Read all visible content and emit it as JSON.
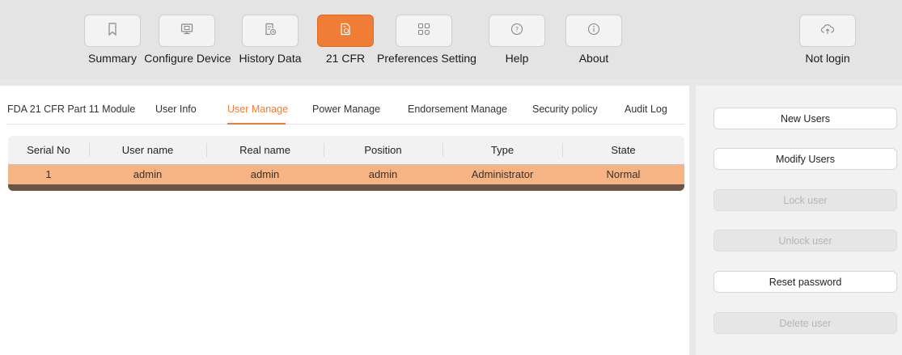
{
  "toolbar": {
    "items": [
      {
        "label": "Summary",
        "icon": "bookmark-icon",
        "active": false
      },
      {
        "label": "Configure Device",
        "icon": "device-icon",
        "active": false
      },
      {
        "label": "History Data",
        "icon": "history-icon",
        "active": false
      },
      {
        "label": "21 CFR",
        "icon": "cfr-icon",
        "active": true
      },
      {
        "label": "Preferences Setting",
        "icon": "grid-icon",
        "active": false
      },
      {
        "label": "Help",
        "icon": "help-icon",
        "active": false
      },
      {
        "label": "About",
        "icon": "info-icon",
        "active": false
      },
      {
        "label": "Not login",
        "icon": "cloud-upload-icon",
        "active": false
      }
    ],
    "accent_color": "#ef7d35"
  },
  "tabs": [
    {
      "label": "FDA 21 CFR Part 11 Module",
      "active": false
    },
    {
      "label": "User Info",
      "active": false
    },
    {
      "label": "User Manage",
      "active": true
    },
    {
      "label": "Power Manage",
      "active": false
    },
    {
      "label": "Endorsement Manage",
      "active": false
    },
    {
      "label": "Security policy",
      "active": false
    },
    {
      "label": "Audit Log",
      "active": false
    }
  ],
  "table": {
    "columns": [
      "Serial No",
      "User name",
      "Real name",
      "Position",
      "Type",
      "State"
    ],
    "rows": [
      [
        "1",
        "admin",
        "admin",
        "admin",
        "Administrator",
        "Normal"
      ]
    ],
    "selected_row_color": "#f6b383"
  },
  "actions": [
    {
      "label": "New Users",
      "enabled": true
    },
    {
      "label": "Modify Users",
      "enabled": true
    },
    {
      "label": "Lock user",
      "enabled": false
    },
    {
      "label": "Unlock user",
      "enabled": false
    },
    {
      "label": "Reset password",
      "enabled": true
    },
    {
      "label": "Delete user",
      "enabled": false
    }
  ]
}
